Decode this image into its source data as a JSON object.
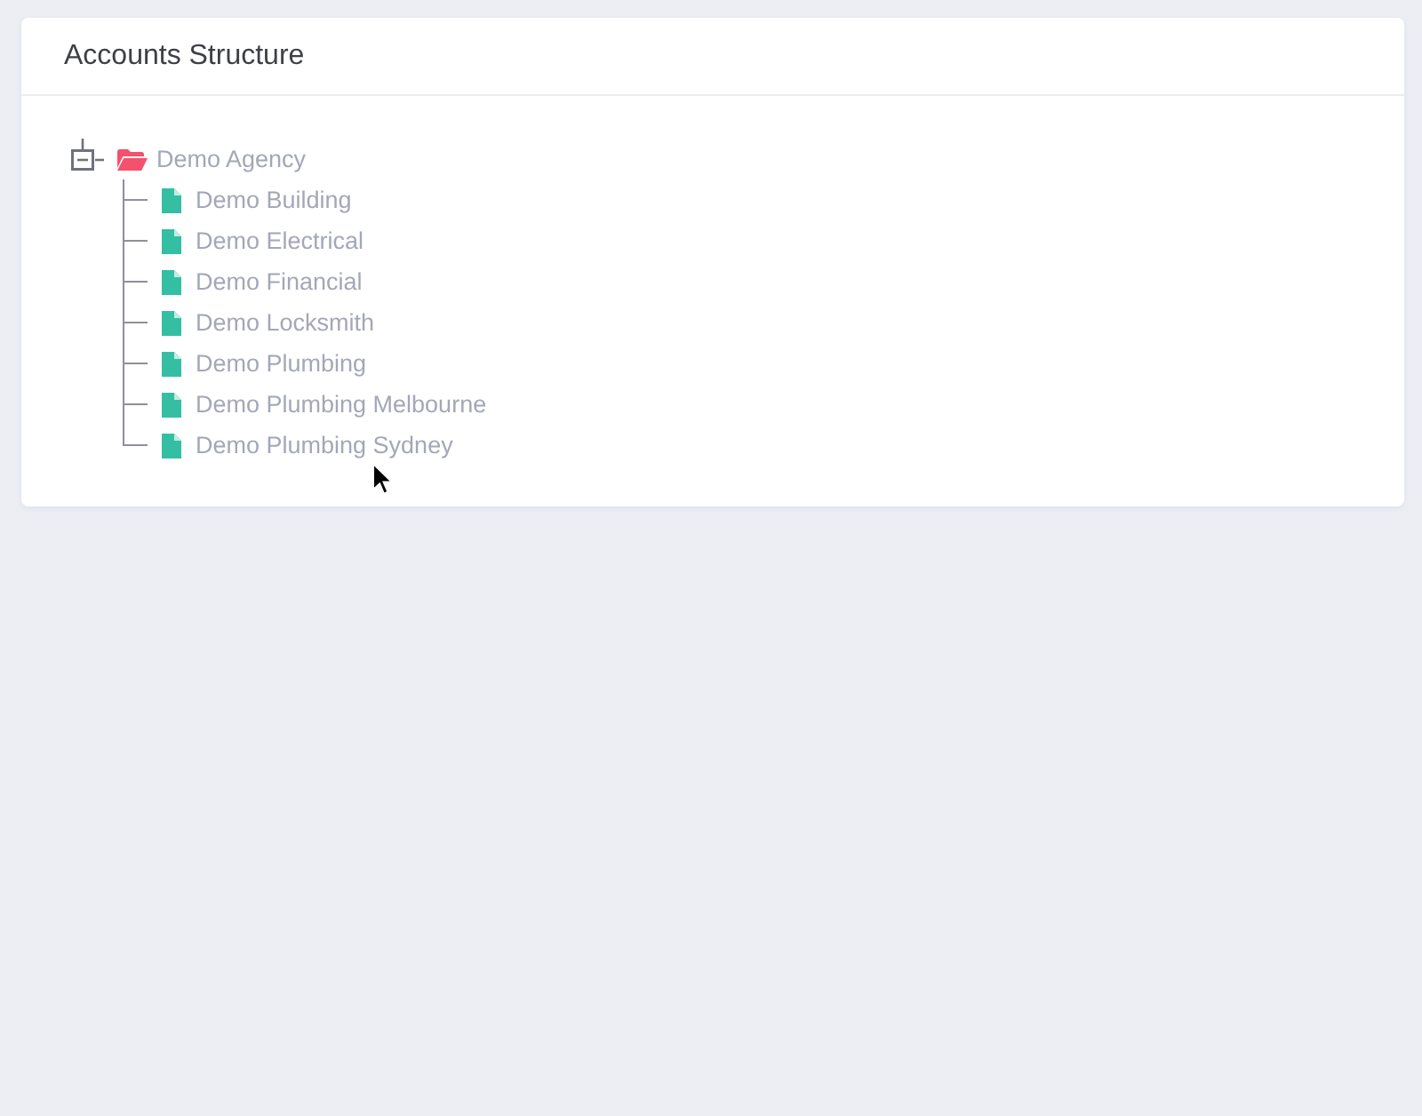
{
  "panel": {
    "title": "Accounts Structure"
  },
  "tree": [
    {
      "label": "Demo Agency",
      "kind": "folder",
      "expanded": true,
      "children": [
        {
          "label": "Demo Building",
          "kind": "file"
        },
        {
          "label": "Demo Electrical",
          "kind": "file"
        },
        {
          "label": "Demo Financial",
          "kind": "file"
        },
        {
          "label": "Demo Locksmith",
          "kind": "file"
        },
        {
          "label": "Demo Plumbing",
          "kind": "file"
        },
        {
          "label": "Demo Plumbing Melbourne",
          "kind": "file"
        },
        {
          "label": "Demo Plumbing Sydney",
          "kind": "file"
        }
      ]
    }
  ]
}
